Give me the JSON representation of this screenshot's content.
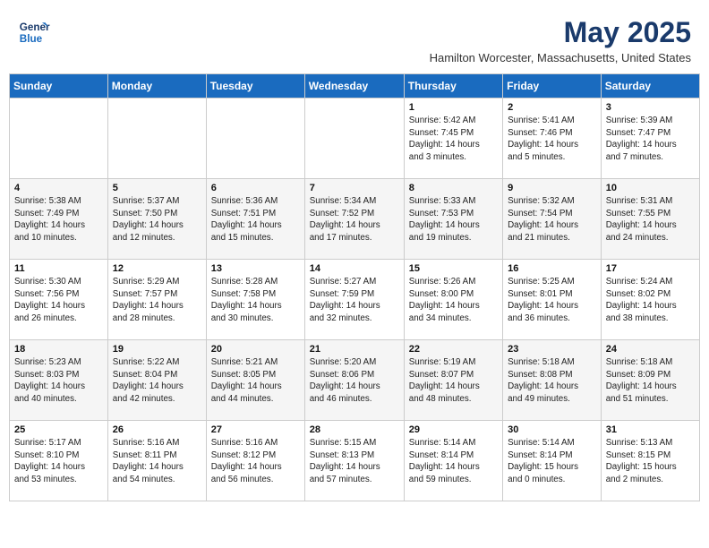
{
  "header": {
    "logo_line1": "General",
    "logo_line2": "Blue",
    "month_year": "May 2025",
    "location": "Hamilton Worcester, Massachusetts, United States"
  },
  "weekdays": [
    "Sunday",
    "Monday",
    "Tuesday",
    "Wednesday",
    "Thursday",
    "Friday",
    "Saturday"
  ],
  "weeks": [
    [
      {
        "day": "",
        "info": ""
      },
      {
        "day": "",
        "info": ""
      },
      {
        "day": "",
        "info": ""
      },
      {
        "day": "",
        "info": ""
      },
      {
        "day": "1",
        "info": "Sunrise: 5:42 AM\nSunset: 7:45 PM\nDaylight: 14 hours\nand 3 minutes."
      },
      {
        "day": "2",
        "info": "Sunrise: 5:41 AM\nSunset: 7:46 PM\nDaylight: 14 hours\nand 5 minutes."
      },
      {
        "day": "3",
        "info": "Sunrise: 5:39 AM\nSunset: 7:47 PM\nDaylight: 14 hours\nand 7 minutes."
      }
    ],
    [
      {
        "day": "4",
        "info": "Sunrise: 5:38 AM\nSunset: 7:49 PM\nDaylight: 14 hours\nand 10 minutes."
      },
      {
        "day": "5",
        "info": "Sunrise: 5:37 AM\nSunset: 7:50 PM\nDaylight: 14 hours\nand 12 minutes."
      },
      {
        "day": "6",
        "info": "Sunrise: 5:36 AM\nSunset: 7:51 PM\nDaylight: 14 hours\nand 15 minutes."
      },
      {
        "day": "7",
        "info": "Sunrise: 5:34 AM\nSunset: 7:52 PM\nDaylight: 14 hours\nand 17 minutes."
      },
      {
        "day": "8",
        "info": "Sunrise: 5:33 AM\nSunset: 7:53 PM\nDaylight: 14 hours\nand 19 minutes."
      },
      {
        "day": "9",
        "info": "Sunrise: 5:32 AM\nSunset: 7:54 PM\nDaylight: 14 hours\nand 21 minutes."
      },
      {
        "day": "10",
        "info": "Sunrise: 5:31 AM\nSunset: 7:55 PM\nDaylight: 14 hours\nand 24 minutes."
      }
    ],
    [
      {
        "day": "11",
        "info": "Sunrise: 5:30 AM\nSunset: 7:56 PM\nDaylight: 14 hours\nand 26 minutes."
      },
      {
        "day": "12",
        "info": "Sunrise: 5:29 AM\nSunset: 7:57 PM\nDaylight: 14 hours\nand 28 minutes."
      },
      {
        "day": "13",
        "info": "Sunrise: 5:28 AM\nSunset: 7:58 PM\nDaylight: 14 hours\nand 30 minutes."
      },
      {
        "day": "14",
        "info": "Sunrise: 5:27 AM\nSunset: 7:59 PM\nDaylight: 14 hours\nand 32 minutes."
      },
      {
        "day": "15",
        "info": "Sunrise: 5:26 AM\nSunset: 8:00 PM\nDaylight: 14 hours\nand 34 minutes."
      },
      {
        "day": "16",
        "info": "Sunrise: 5:25 AM\nSunset: 8:01 PM\nDaylight: 14 hours\nand 36 minutes."
      },
      {
        "day": "17",
        "info": "Sunrise: 5:24 AM\nSunset: 8:02 PM\nDaylight: 14 hours\nand 38 minutes."
      }
    ],
    [
      {
        "day": "18",
        "info": "Sunrise: 5:23 AM\nSunset: 8:03 PM\nDaylight: 14 hours\nand 40 minutes."
      },
      {
        "day": "19",
        "info": "Sunrise: 5:22 AM\nSunset: 8:04 PM\nDaylight: 14 hours\nand 42 minutes."
      },
      {
        "day": "20",
        "info": "Sunrise: 5:21 AM\nSunset: 8:05 PM\nDaylight: 14 hours\nand 44 minutes."
      },
      {
        "day": "21",
        "info": "Sunrise: 5:20 AM\nSunset: 8:06 PM\nDaylight: 14 hours\nand 46 minutes."
      },
      {
        "day": "22",
        "info": "Sunrise: 5:19 AM\nSunset: 8:07 PM\nDaylight: 14 hours\nand 48 minutes."
      },
      {
        "day": "23",
        "info": "Sunrise: 5:18 AM\nSunset: 8:08 PM\nDaylight: 14 hours\nand 49 minutes."
      },
      {
        "day": "24",
        "info": "Sunrise: 5:18 AM\nSunset: 8:09 PM\nDaylight: 14 hours\nand 51 minutes."
      }
    ],
    [
      {
        "day": "25",
        "info": "Sunrise: 5:17 AM\nSunset: 8:10 PM\nDaylight: 14 hours\nand 53 minutes."
      },
      {
        "day": "26",
        "info": "Sunrise: 5:16 AM\nSunset: 8:11 PM\nDaylight: 14 hours\nand 54 minutes."
      },
      {
        "day": "27",
        "info": "Sunrise: 5:16 AM\nSunset: 8:12 PM\nDaylight: 14 hours\nand 56 minutes."
      },
      {
        "day": "28",
        "info": "Sunrise: 5:15 AM\nSunset: 8:13 PM\nDaylight: 14 hours\nand 57 minutes."
      },
      {
        "day": "29",
        "info": "Sunrise: 5:14 AM\nSunset: 8:14 PM\nDaylight: 14 hours\nand 59 minutes."
      },
      {
        "day": "30",
        "info": "Sunrise: 5:14 AM\nSunset: 8:14 PM\nDaylight: 15 hours\nand 0 minutes."
      },
      {
        "day": "31",
        "info": "Sunrise: 5:13 AM\nSunset: 8:15 PM\nDaylight: 15 hours\nand 2 minutes."
      }
    ]
  ]
}
